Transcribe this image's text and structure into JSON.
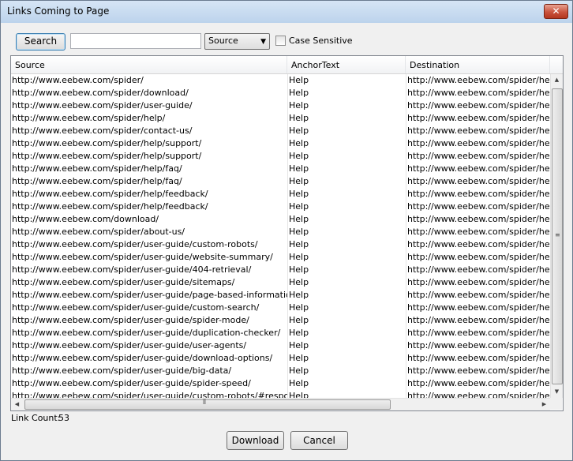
{
  "window": {
    "title": "Links Coming to Page",
    "close_glyph": "✕"
  },
  "toolbar": {
    "search_label": "Search",
    "search_value": "",
    "search_placeholder": "",
    "filter_selected": "Source",
    "case_sensitive_label": "Case Sensitive",
    "case_sensitive_checked": false
  },
  "table": {
    "columns": [
      "Source",
      "AnchorText",
      "Destination"
    ],
    "rows": [
      [
        "http://www.eebew.com/spider/",
        "Help",
        "http://www.eebew.com/spider/help/"
      ],
      [
        "http://www.eebew.com/spider/download/",
        "Help",
        "http://www.eebew.com/spider/help/"
      ],
      [
        "http://www.eebew.com/spider/user-guide/",
        "Help",
        "http://www.eebew.com/spider/help/"
      ],
      [
        "http://www.eebew.com/spider/help/",
        "Help",
        "http://www.eebew.com/spider/help/"
      ],
      [
        "http://www.eebew.com/spider/contact-us/",
        "Help",
        "http://www.eebew.com/spider/help/"
      ],
      [
        "http://www.eebew.com/spider/help/support/",
        "Help",
        "http://www.eebew.com/spider/help/"
      ],
      [
        "http://www.eebew.com/spider/help/support/",
        "Help",
        "http://www.eebew.com/spider/help/"
      ],
      [
        "http://www.eebew.com/spider/help/faq/",
        "Help",
        "http://www.eebew.com/spider/help/"
      ],
      [
        "http://www.eebew.com/spider/help/faq/",
        "Help",
        "http://www.eebew.com/spider/help/"
      ],
      [
        "http://www.eebew.com/spider/help/feedback/",
        "Help",
        "http://www.eebew.com/spider/help/"
      ],
      [
        "http://www.eebew.com/spider/help/feedback/",
        "Help",
        "http://www.eebew.com/spider/help/"
      ],
      [
        "http://www.eebew.com/download/",
        "Help",
        "http://www.eebew.com/spider/help/"
      ],
      [
        "http://www.eebew.com/spider/about-us/",
        "Help",
        "http://www.eebew.com/spider/help/"
      ],
      [
        "http://www.eebew.com/spider/user-guide/custom-robots/",
        "Help",
        "http://www.eebew.com/spider/help/"
      ],
      [
        "http://www.eebew.com/spider/user-guide/website-summary/",
        "Help",
        "http://www.eebew.com/spider/help/"
      ],
      [
        "http://www.eebew.com/spider/user-guide/404-retrieval/",
        "Help",
        "http://www.eebew.com/spider/help/"
      ],
      [
        "http://www.eebew.com/spider/user-guide/sitemaps/",
        "Help",
        "http://www.eebew.com/spider/help/"
      ],
      [
        "http://www.eebew.com/spider/user-guide/page-based-information/",
        "Help",
        "http://www.eebew.com/spider/help/"
      ],
      [
        "http://www.eebew.com/spider/user-guide/custom-search/",
        "Help",
        "http://www.eebew.com/spider/help/"
      ],
      [
        "http://www.eebew.com/spider/user-guide/spider-mode/",
        "Help",
        "http://www.eebew.com/spider/help/"
      ],
      [
        "http://www.eebew.com/spider/user-guide/duplication-checker/",
        "Help",
        "http://www.eebew.com/spider/help/"
      ],
      [
        "http://www.eebew.com/spider/user-guide/user-agents/",
        "Help",
        "http://www.eebew.com/spider/help/"
      ],
      [
        "http://www.eebew.com/spider/user-guide/download-options/",
        "Help",
        "http://www.eebew.com/spider/help/"
      ],
      [
        "http://www.eebew.com/spider/user-guide/big-data/",
        "Help",
        "http://www.eebew.com/spider/help/"
      ],
      [
        "http://www.eebew.com/spider/user-guide/spider-speed/",
        "Help",
        "http://www.eebew.com/spider/help/"
      ],
      [
        "http://www.eebew.com/spider/user-guide/custom-robots/#respond",
        "Help",
        "http://www.eebew.com/spider/help/"
      ]
    ]
  },
  "footer": {
    "link_count_label": "Link Count:",
    "link_count_value": "53",
    "download_label": "Download",
    "cancel_label": "Cancel"
  }
}
